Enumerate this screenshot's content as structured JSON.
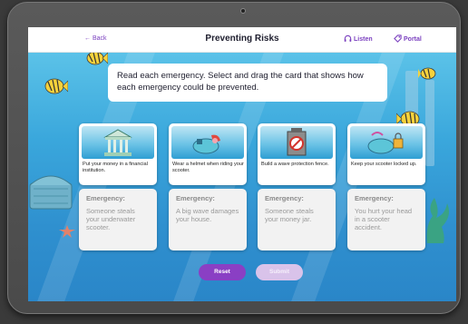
{
  "header": {
    "back_label": "← Back",
    "title": "Preventing Risks",
    "listen_label": "Listen",
    "portal_label": "Portal"
  },
  "instruction": "Read each emergency. Select and drag the card that shows how each emergency could be prevented.",
  "prevention_cards": [
    {
      "caption": "Put your money in a financial institution.",
      "icon": "bank-icon"
    },
    {
      "caption": "Wear a helmet when riding your scooter.",
      "icon": "helmet-scooter-icon"
    },
    {
      "caption": "Build a wave protection fence.",
      "icon": "no-wave-sign-icon"
    },
    {
      "caption": "Keep your scooter locked up.",
      "icon": "locked-scooter-icon"
    }
  ],
  "emergency_cards": [
    {
      "label": "Emergency:",
      "text": "Someone steals your underwater scooter."
    },
    {
      "label": "Emergency:",
      "text": "A big wave damages your house."
    },
    {
      "label": "Emergency:",
      "text": "Someone steals your money jar."
    },
    {
      "label": "Emergency:",
      "text": "You hurt your head in a scooter accident."
    }
  ],
  "buttons": {
    "reset": "Reset",
    "submit": "Submit"
  },
  "colors": {
    "accent": "#8a3fc4",
    "link": "#7a3fbf",
    "water": "#3aa7dc"
  }
}
